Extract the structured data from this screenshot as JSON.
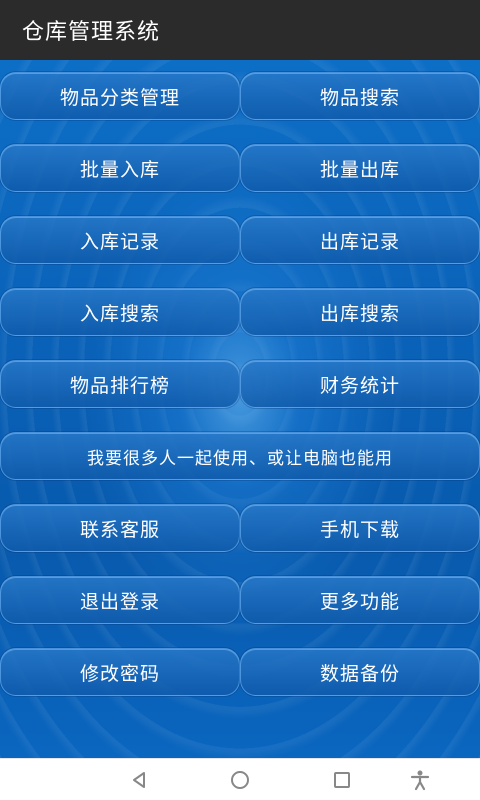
{
  "app": {
    "title": "仓库管理系统"
  },
  "menu": {
    "rows": [
      {
        "left": "物品分类管理",
        "right": "物品搜索"
      },
      {
        "left": "批量入库",
        "right": "批量出库"
      },
      {
        "left": "入库记录",
        "right": "出库记录"
      },
      {
        "left": "入库搜索",
        "right": "出库搜索"
      },
      {
        "left": "物品排行榜",
        "right": "财务统计"
      },
      {
        "full": "我要很多人一起使用、或让电脑也能用"
      },
      {
        "left": "联系客服",
        "right": "手机下载"
      },
      {
        "left": "退出登录",
        "right": "更多功能"
      },
      {
        "left": "修改密码",
        "right": "数据备份"
      }
    ]
  },
  "navbar": {
    "icons": [
      "back-icon",
      "home-icon",
      "recents-icon",
      "accessibility-icon"
    ],
    "icon_color": "#888888"
  },
  "colors": {
    "appbar": "#2b2b2b",
    "accent": "#0b5fb0"
  }
}
